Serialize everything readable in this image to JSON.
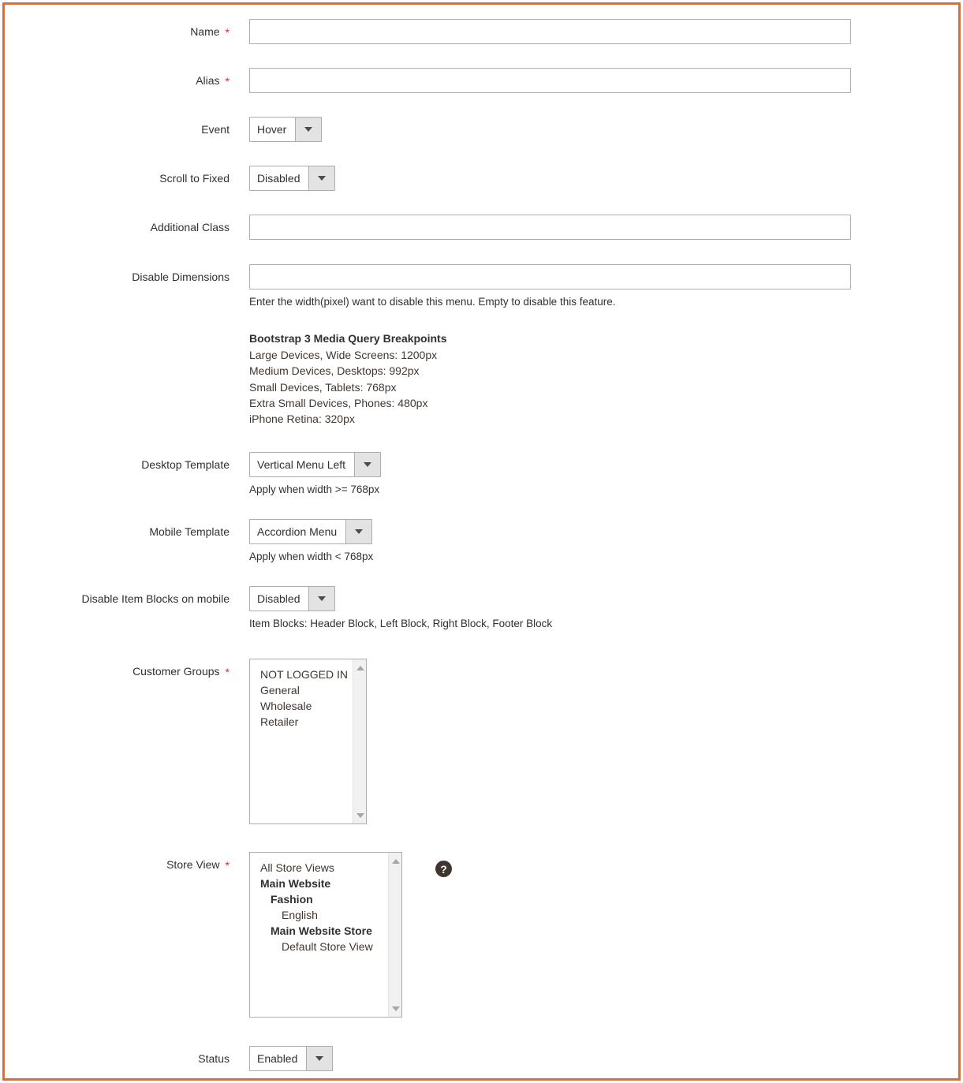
{
  "form": {
    "fields": {
      "name": {
        "label": "Name",
        "required": true,
        "value": "",
        "placeholder": ""
      },
      "alias": {
        "label": "Alias",
        "required": true,
        "value": "",
        "placeholder": ""
      },
      "event": {
        "label": "Event",
        "required": false,
        "value": "Hover"
      },
      "scroll_to_fixed": {
        "label": "Scroll to Fixed",
        "required": false,
        "value": "Disabled"
      },
      "additional_class": {
        "label": "Additional Class",
        "required": false,
        "value": "",
        "placeholder": ""
      },
      "disable_dimensions": {
        "label": "Disable Dimensions",
        "required": false,
        "value": "",
        "placeholder": "",
        "note": "Enter the width(pixel) want to disable this menu. Empty to disable this feature."
      },
      "desktop_template": {
        "label": "Desktop Template",
        "required": false,
        "value": "Vertical Menu Left",
        "note": "Apply when width >= 768px"
      },
      "mobile_template": {
        "label": "Mobile Template",
        "required": false,
        "value": "Accordion Menu",
        "note": "Apply when width < 768px"
      },
      "disable_item_blocks": {
        "label": "Disable Item Blocks on mobile",
        "required": false,
        "value": "Disabled",
        "note": "Item Blocks: Header Block, Left Block, Right Block, Footer Block"
      },
      "customer_groups": {
        "label": "Customer Groups",
        "required": true,
        "options": [
          {
            "text": "NOT LOGGED IN",
            "level": 1,
            "bold": false
          },
          {
            "text": "General",
            "level": 1,
            "bold": false
          },
          {
            "text": "Wholesale",
            "level": 1,
            "bold": false
          },
          {
            "text": "Retailer",
            "level": 1,
            "bold": false
          }
        ]
      },
      "store_view": {
        "label": "Store View",
        "required": true,
        "help_icon": "question-mark-icon",
        "options": [
          {
            "text": "All Store Views",
            "level": 1,
            "bold": false
          },
          {
            "text": "Main Website",
            "level": 1,
            "bold": true
          },
          {
            "text": "Fashion",
            "level": 2,
            "bold": true
          },
          {
            "text": "English",
            "level": 3,
            "bold": false
          },
          {
            "text": "Main Website Store",
            "level": 2,
            "bold": true
          },
          {
            "text": "Default Store View",
            "level": 3,
            "bold": false
          }
        ]
      },
      "status": {
        "label": "Status",
        "required": false,
        "value": "Enabled"
      }
    },
    "breakpoints": {
      "title": "Bootstrap 3 Media Query Breakpoints",
      "lines": [
        "Large Devices, Wide Screens: 1200px",
        "Medium Devices, Desktops: 992px",
        "Small Devices, Tablets: 768px",
        "Extra Small Devices, Phones: 480px",
        "iPhone Retina: 320px"
      ]
    },
    "icons": {
      "dropdown_arrow": "chevron-down-icon",
      "scroll_up": "scroll-up-arrow-icon",
      "scroll_down": "scroll-down-arrow-icon"
    },
    "colors": {
      "frame_border": "#f4661c",
      "required_asterisk": "#e22626",
      "label_text": "#303030",
      "input_border": "#adadad"
    }
  }
}
